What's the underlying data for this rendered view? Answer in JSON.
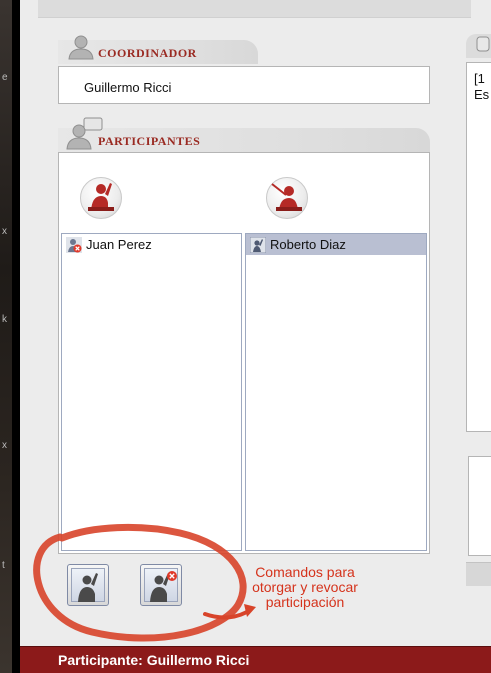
{
  "coordinator": {
    "title": "COORDINADOR",
    "name": "Guillermo Ricci"
  },
  "participants": {
    "title": "PARTICIPANTES",
    "list_left": [
      {
        "name": "Juan Perez",
        "icon": "user-revoked-icon",
        "selected": false
      }
    ],
    "list_right": [
      {
        "name": "Roberto Diaz",
        "icon": "user-hand-icon",
        "selected": true
      }
    ]
  },
  "chat_preview": {
    "line1": "[1",
    "line2": "Es"
  },
  "annotation": {
    "line1": "Comandos para",
    "line2": "otorgar y revocar",
    "line3": "participación"
  },
  "status_bar": {
    "text": "Participante:  Guillermo Ricci"
  },
  "left_strip_marks": [
    "e",
    "x",
    "k",
    "x",
    "t"
  ],
  "colors": {
    "accent_red": "#9a2a22",
    "status_bar": "#8c1a1a",
    "annotation": "#d5331c",
    "selection": "#b9bfd2"
  }
}
